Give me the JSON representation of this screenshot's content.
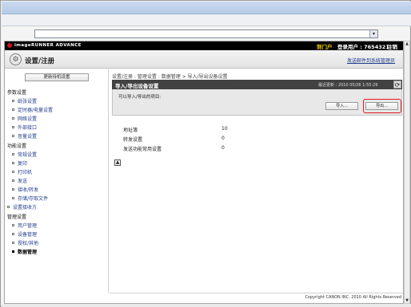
{
  "header": {
    "brand": "imageRUNNER ADVANCE",
    "portal": "到门户",
    "login_user": "登录用户 : 7654321",
    "logout": "注销"
  },
  "title_bar": {
    "page_title": "设置/注册",
    "admin_mail": "发送邮件到系统管理员"
  },
  "sidebar": {
    "confirm_button": "更新待机设置",
    "sections": [
      {
        "label": "参数设置",
        "items": [
          "纸张设置",
          "定时器/电量设置",
          "网络设置",
          "外部接口",
          "音量设置"
        ]
      },
      {
        "label": "功能设置",
        "items": [
          "常规设置",
          "复印",
          "打印机",
          "发送",
          "接收/转发",
          "存储/存取文件"
        ]
      },
      {
        "label": "设置接收方",
        "items": []
      },
      {
        "label": "管理设置",
        "items": [
          "用户管理",
          "设备管理",
          "授权/其他",
          "数据管理"
        ]
      }
    ],
    "current_item": "数据管理"
  },
  "main": {
    "breadcrumb": "设置/注册 : 管理设置 : 数据管理 > 导入/导出设备设置",
    "panel_title": "导入/导出设备设置",
    "last_update_label": "最近更新",
    "last_update": "2010 05/26 1:55:29",
    "panel_message": "可以导入/导出的项目:",
    "import_button": "导入...",
    "export_button": "导出...",
    "rows": [
      {
        "label": "地址簿",
        "value": "10"
      },
      {
        "label": "转发设置",
        "value": "0"
      },
      {
        "label": "发送功能常用设置",
        "value": "0"
      }
    ]
  },
  "footer": {
    "copyright": "Copyright CANON INC. 2010 All Rights Reserved"
  },
  "colors": {
    "highlight": "#e0181e",
    "link": "#1f3d8f",
    "portal": "#f0d000",
    "header_bg": "#000000"
  },
  "icons": {
    "refresh": "refresh-icon",
    "settings": "gear-icon",
    "page_top": "page-top-icon"
  }
}
